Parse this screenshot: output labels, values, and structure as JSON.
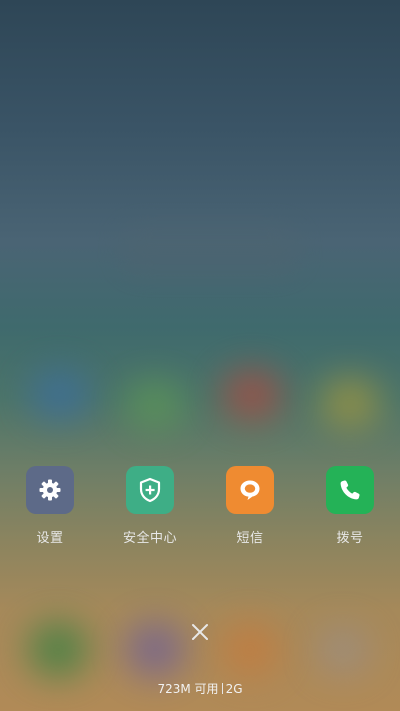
{
  "recent_apps": [
    {
      "label": "设置",
      "icon": "gear-icon",
      "color": "#5d6a88"
    },
    {
      "label": "安全中心",
      "icon": "shield-plus-icon",
      "color": "#3eae86"
    },
    {
      "label": "短信",
      "icon": "message-bubble-icon",
      "color": "#ef8b31"
    },
    {
      "label": "拨号",
      "icon": "phone-icon",
      "color": "#24b257"
    }
  ],
  "close_icon": "close-icon",
  "memory": {
    "available": "723M 可用",
    "total": "2G"
  }
}
